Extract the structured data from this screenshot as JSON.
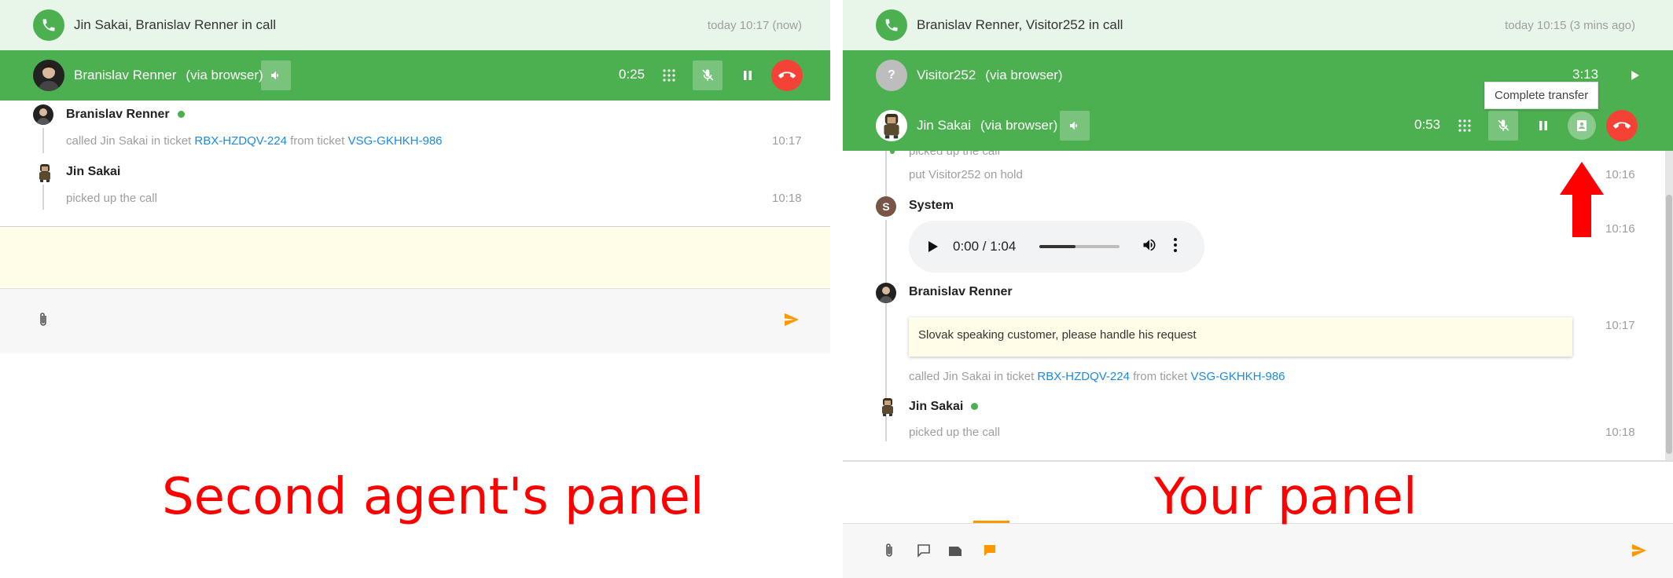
{
  "left": {
    "call_bar": {
      "title": "Jin Sakai, Branislav Renner in call",
      "time": "today 10:17 (now)"
    },
    "participant": {
      "name": "Branislav Renner",
      "via": "(via browser)",
      "timer": "0:25"
    },
    "entries": [
      {
        "name": "Branislav Renner",
        "text_prefix": "called Jin Sakai in ticket ",
        "link1": "RBX-HZDQV-224",
        "text_middle": " from ticket ",
        "link2": "VSG-GKHKH-986",
        "time": "10:17"
      },
      {
        "name": "Jin Sakai",
        "text": "picked up the call",
        "time": "10:18"
      }
    ],
    "caption": "Second agent's panel"
  },
  "right": {
    "call_bar": {
      "title": "Branislav Renner, Visitor252 in call",
      "time": "today 10:15 (3 mins ago)"
    },
    "held": {
      "avatar": "?",
      "name": "Visitor252",
      "via": "(via browser)",
      "timer": "3:13"
    },
    "participant": {
      "name": "Jin Sakai",
      "via": "(via browser)",
      "timer": "0:53"
    },
    "tooltip": "Complete transfer",
    "entries": {
      "partial": "picked up the call",
      "hold": {
        "text": "put Visitor252 on hold",
        "time": "10:16"
      },
      "system": {
        "avatar": "S",
        "name": "System",
        "time": "10:16",
        "audio_time": "0:00 / 1:04",
        "audio_progress": 0.45
      },
      "renner": {
        "name": "Branislav Renner",
        "note": "Slovak speaking customer, please handle his request",
        "time": "10:17",
        "text_prefix": "called Jin Sakai in ticket ",
        "link1": "RBX-HZDQV-224",
        "text_middle": " from ticket ",
        "link2": "VSG-GKHKH-986"
      },
      "jin": {
        "name": "Jin Sakai",
        "text": "picked up the call",
        "time": "10:18"
      }
    },
    "caption": "Your panel"
  },
  "colors": {
    "green": "#4caf50",
    "light_green": "#e8f5e9",
    "red": "#f44336",
    "link": "#1e88e5",
    "accent": "#ff9800",
    "annotation": "#ff0000"
  }
}
